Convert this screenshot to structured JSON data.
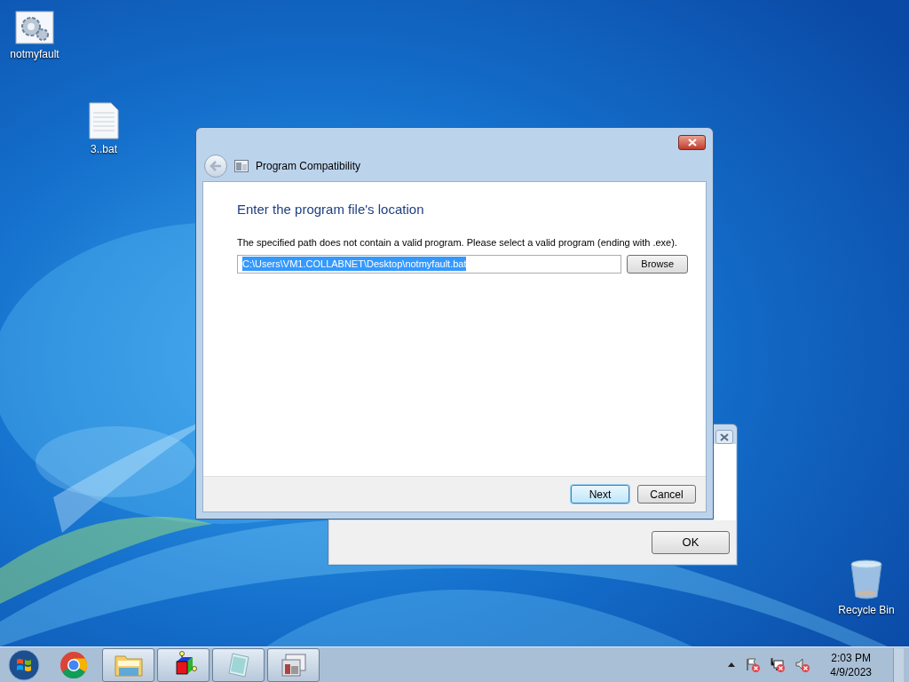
{
  "desktop_icons": [
    {
      "label": "notmyfault",
      "kind": "settings-file"
    },
    {
      "label": "3..bat",
      "kind": "text-file"
    },
    {
      "label": "Recycle Bin",
      "kind": "recycle-bin"
    }
  ],
  "back_window": {
    "buttons": [
      "OK"
    ]
  },
  "dialog": {
    "title": "Program Compatibility",
    "heading": "Enter the program file's location",
    "message": "The specified path does not contain a valid program.  Please select a valid program (ending with .exe).",
    "path_field": {
      "value": "C:\\Users\\VM1.COLLABNET\\Desktop\\notmyfault.bat",
      "selected": true
    },
    "browse_button": "Browse",
    "buttons": [
      {
        "label": "Next",
        "default": true
      },
      {
        "label": "Cancel",
        "default": false
      }
    ]
  },
  "taskbar": {
    "apps": [
      {
        "kind": "chrome",
        "running": false
      },
      {
        "kind": "explorer",
        "running": true
      },
      {
        "kind": "cube",
        "running": true
      },
      {
        "kind": "notepad",
        "running": true
      },
      {
        "kind": "window-app",
        "running": true
      }
    ],
    "clock": {
      "time": "2:03 PM",
      "date": "4/9/2023"
    }
  }
}
